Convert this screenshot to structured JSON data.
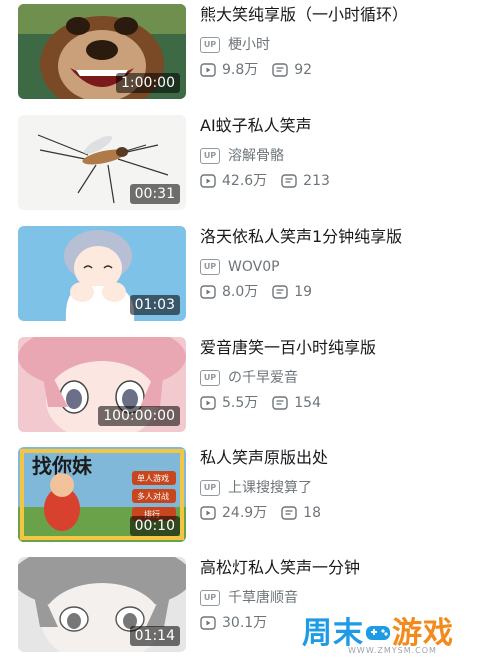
{
  "videos": [
    {
      "title": "熊大笑纯享版（一小时循环）",
      "uploader": "梗小时",
      "views": "9.8万",
      "comments": "92",
      "duration": "1:00:00",
      "thumb": "bear"
    },
    {
      "title": "AI蚊子私人笑声",
      "uploader": "溶解骨骼",
      "views": "42.6万",
      "comments": "213",
      "duration": "00:31",
      "thumb": "mosquito"
    },
    {
      "title": "洛天依私人笑声1分钟纯享版",
      "uploader": "WOV0P",
      "views": "8.0万",
      "comments": "19",
      "duration": "01:03",
      "thumb": "anime-blue"
    },
    {
      "title": "爱音唐笑一百小时纯享版",
      "uploader": "の千早爱音",
      "views": "5.5万",
      "comments": "154",
      "duration": "100:00:00",
      "thumb": "anime-pink"
    },
    {
      "title": "私人笑声原版出处",
      "uploader": "上课搜搜算了",
      "views": "24.9万",
      "comments": "18",
      "duration": "00:10",
      "thumb": "game"
    },
    {
      "title": "高松灯私人笑声一分钟",
      "uploader": "千草唐顺音",
      "views": "30.1万",
      "comments": "",
      "duration": "01:14",
      "thumb": "anime-gray"
    }
  ],
  "labels": {
    "up_badge": "UP",
    "game_title": "找你妹",
    "game_menu": [
      "单人游戏",
      "多人对战",
      "排行"
    ]
  },
  "watermark": {
    "text_a": "周末",
    "text_b": "游戏",
    "url": "WWW.ZMYSM.COM",
    "colors": {
      "blue": "#1e9be6",
      "orange": "#f28a1c"
    }
  },
  "icons": {
    "views": "play-count-icon",
    "comments": "danmaku-icon"
  }
}
